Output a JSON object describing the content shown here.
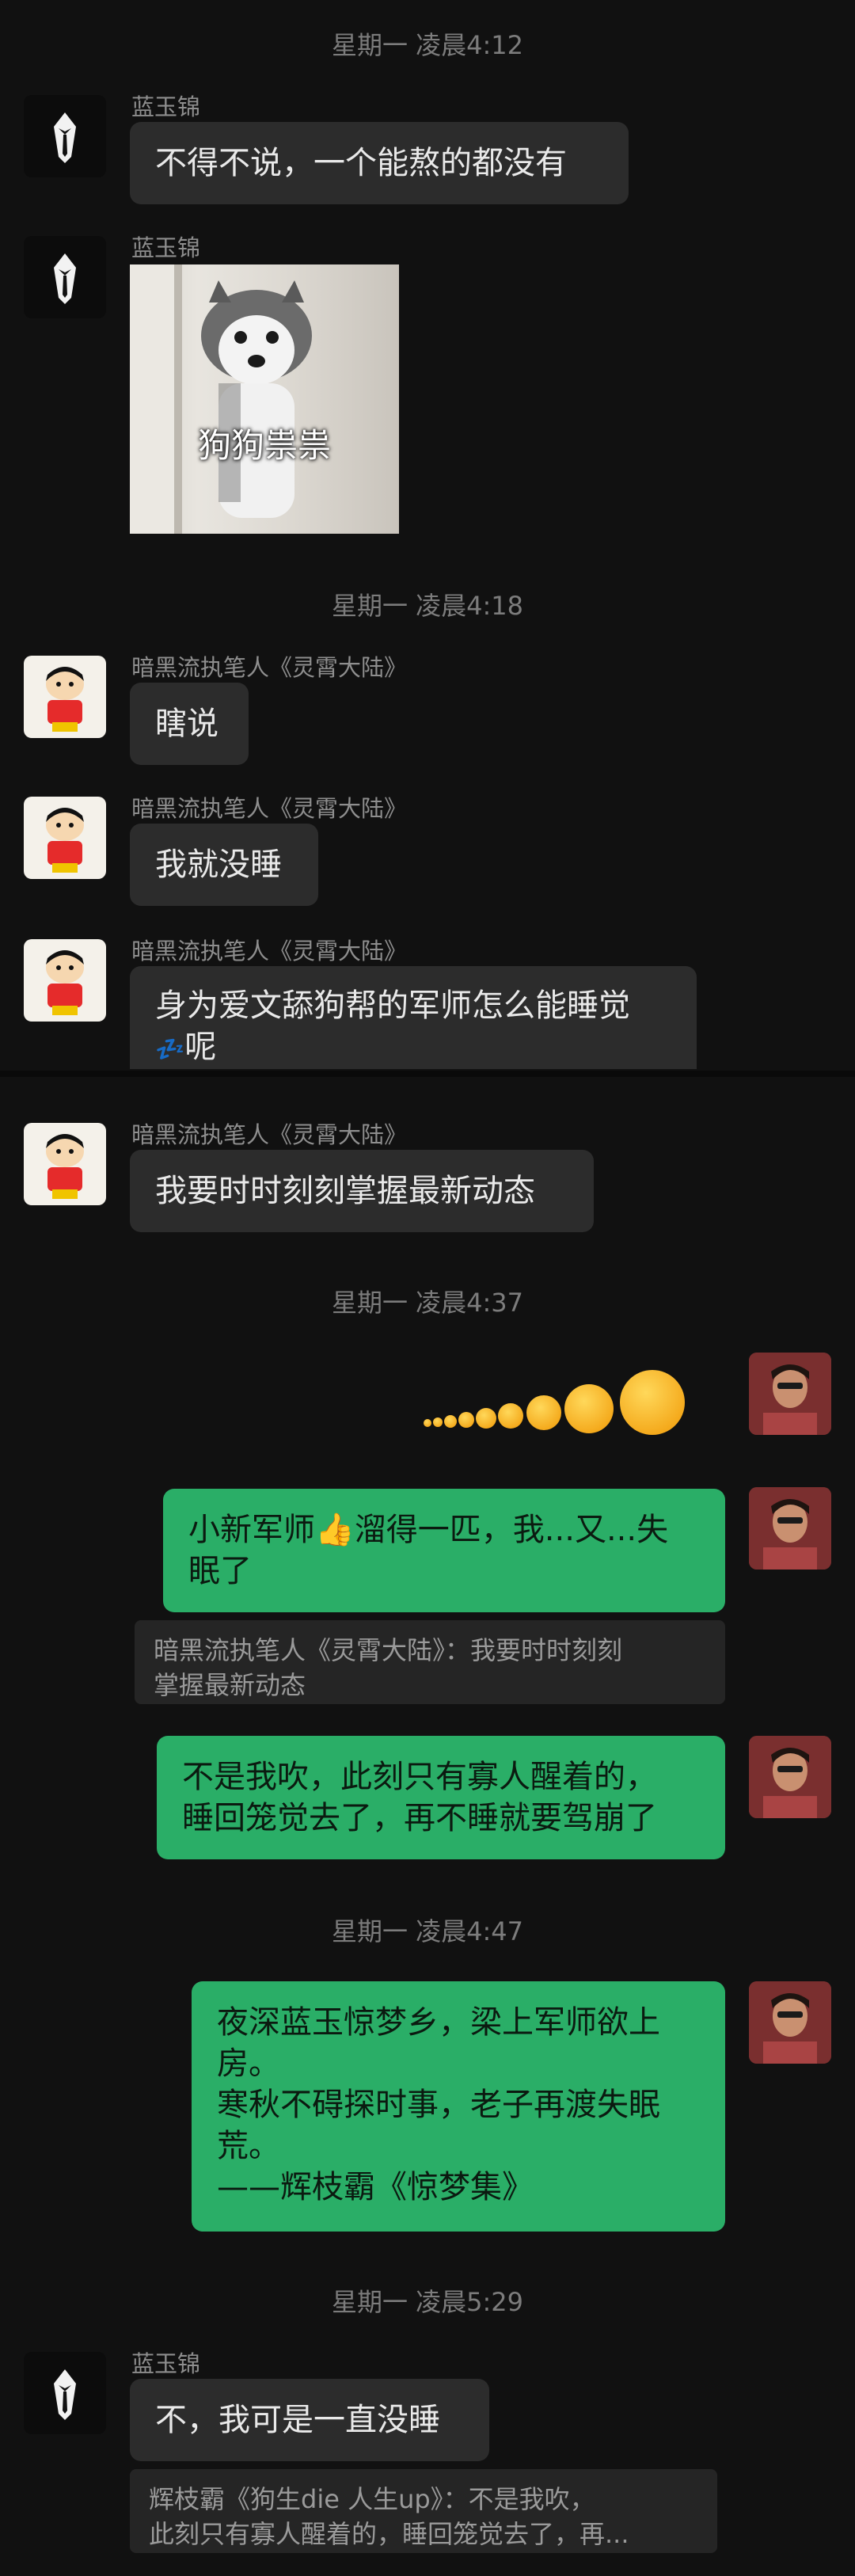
{
  "conversation": {
    "timestamps": [
      "星期一 凌晨4:12",
      "星期一 凌晨4:18",
      "星期一 凌晨4:37",
      "星期一 凌晨4:47",
      "星期一 凌晨5:29"
    ],
    "messages": [
      {
        "sender": "蓝玉锦",
        "text": "不得不说，一个能熬的都没有"
      },
      {
        "sender": "蓝玉锦",
        "sticker_caption": "狗狗祟祟"
      },
      {
        "sender": "暗黑流执笔人《灵霄大陆》",
        "text": "瞎说"
      },
      {
        "sender": "暗黑流执笔人《灵霄大陆》",
        "text": "我就没睡"
      },
      {
        "sender": "暗黑流执笔人《灵霄大陆》",
        "text_line1": "身为爱文舔狗帮的军师怎么能睡觉",
        "text_line2": "呢",
        "sleep_emoji": "💤"
      },
      {
        "sender": "暗黑流执笔人《灵霄大陆》",
        "text": "我要时时刻刻掌握最新动态"
      },
      {
        "text_line1": "小新军师👍溜得一匹，我...又...失",
        "text_line2": "眠了"
      },
      {
        "text_line1": "不是我吹，此刻只有寡人醒着的，",
        "text_line2": "睡回笼觉去了，再不睡就要驾崩了"
      },
      {
        "lines": [
          "夜深蓝玉惊梦乡，梁上军师欲上",
          "房。",
          "寒秋不碍探时事，老子再渡失眠",
          "荒。",
          "——辉枝霸《惊梦集》"
        ]
      },
      {
        "sender": "蓝玉锦",
        "text": "不，我可是一直没睡"
      }
    ],
    "quotes": [
      {
        "line1": "暗黑流执笔人《灵霄大陆》：我要时时刻刻",
        "line2": "掌握最新动态"
      },
      {
        "line1": "辉枝霸《狗生die 人生up》：不是我吹，",
        "line2": "此刻只有寡人醒着的，睡回笼觉去了，再..."
      }
    ]
  },
  "colors": {
    "background": "#111111",
    "incoming_bubble": "#2c2c2c",
    "outgoing_bubble": "#2aae67",
    "timestamp": "#7c7c7c"
  }
}
